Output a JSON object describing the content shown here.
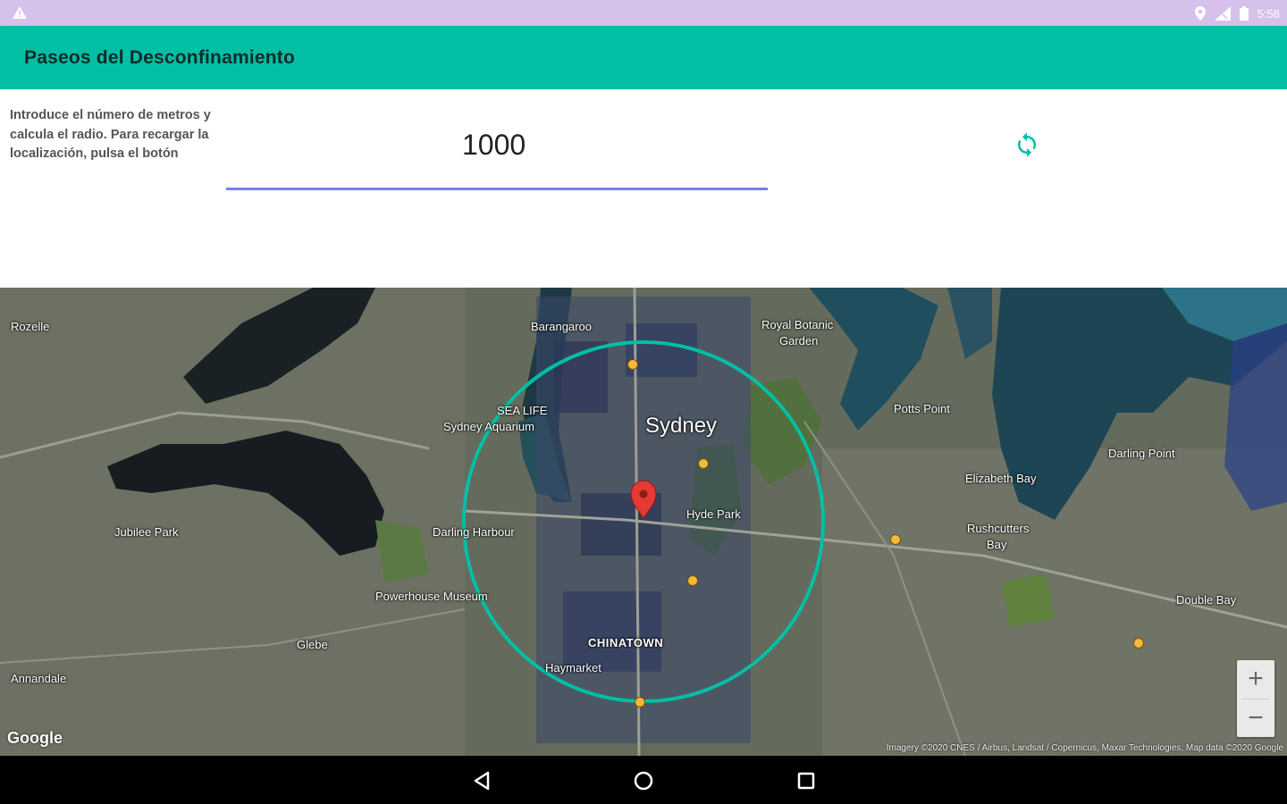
{
  "status_bar": {
    "time": "5:58",
    "icons": [
      "warning-icon",
      "location-icon",
      "signal-icon",
      "battery-icon"
    ]
  },
  "app_bar": {
    "title": "Paseos del Desconfinamiento",
    "color": "#00bfa5"
  },
  "form": {
    "hint": "Introduce el número de metros y calcula el radio. Para recargar la localización, pulsa el botón",
    "meters_value": "1000",
    "refresh_icon": "refresh-icon",
    "accent_color": "#7b7ff0"
  },
  "map": {
    "center_label": "Sydney",
    "labels": {
      "rozelle": "Rozelle",
      "barangaroo": "Barangaroo",
      "royal_botanic": "Royal Botanic",
      "garden": "Garden",
      "sea_life": "SEA LIFE",
      "sydney_aquarium": "Sydney Aquarium",
      "darling_point": "Darling Point",
      "elizabeth_bay": "Elizabeth Bay",
      "rushcutters": "Rushcutters",
      "bay": "Bay",
      "jubilee_park": "Jubilee Park",
      "darling_harbour": "Darling Harbour",
      "hyde_park": "Hyde Park",
      "powerhouse": "Powerhouse Museum",
      "chinatown": "CHINATOWN",
      "haymarket": "Haymarket",
      "glebe": "Glebe",
      "annandale": "Annandale",
      "double_bay": "Double Bay",
      "potts_point": "Potts Point"
    },
    "zoom_in": "+",
    "zoom_out": "−",
    "logo": "Google",
    "attribution": "Imagery ©2020 CNES / Airbus, Landsat / Copernicus, Maxar Technologies, Map data ©2020 Google",
    "radius_color": "#00bfa5",
    "marker_color": "#e53935"
  },
  "nav_bar": {
    "icons": [
      "back-icon",
      "home-icon",
      "recents-icon"
    ]
  }
}
